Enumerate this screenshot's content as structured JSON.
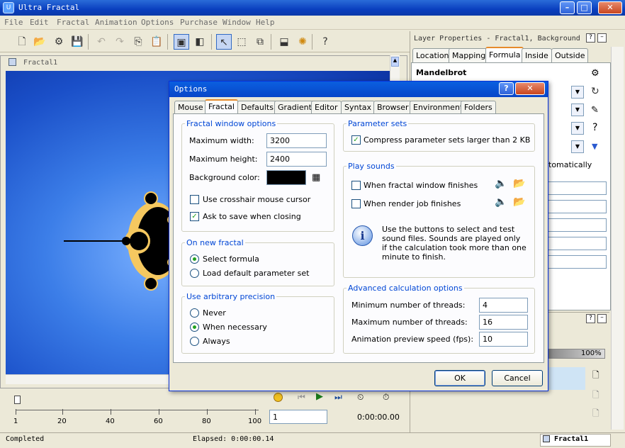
{
  "window": {
    "title": "Ultra Fractal",
    "icon_letter": "U"
  },
  "menu": [
    "File",
    "Edit",
    "Fractal",
    "Animation",
    "Options",
    "Purchase",
    "Window",
    "Help"
  ],
  "document": {
    "title": "Fractal1"
  },
  "timeline": {
    "ticks": [
      "1",
      "20",
      "40",
      "60",
      "80",
      "100"
    ],
    "frame": "1",
    "time": "0:00:00.00"
  },
  "status": {
    "left": "Completed",
    "elapsed": "Elapsed: 0:00:00.14",
    "tab": "Fractal1"
  },
  "layer_panel": {
    "title": "Layer Properties - Fractal1, Background",
    "tabs": [
      "Location",
      "Mapping",
      "Formula",
      "Inside",
      "Outside"
    ],
    "active_tab": "Formula",
    "formula_name": "Mandelbrot",
    "auto_text": "tomatically",
    "progress": "100%"
  },
  "dialog": {
    "title": "Options",
    "tabs": [
      "Mouse",
      "Fractal",
      "Defaults",
      "Gradient",
      "Editor",
      "Syntax",
      "Browser",
      "Environment",
      "Folders"
    ],
    "active_tab": "Fractal",
    "fractal_window": {
      "group_label": "Fractal window options",
      "max_width_label": "Maximum width:",
      "max_width": "3200",
      "max_height_label": "Maximum height:",
      "max_height": "2400",
      "bg_color_label": "Background color:",
      "bg_color": "#000000",
      "crosshair_label": "Use crosshair mouse cursor",
      "crosshair_checked": false,
      "ask_save_label": "Ask to save when closing",
      "ask_save_checked": true
    },
    "new_fractal": {
      "group_label": "On new fractal",
      "options": [
        "Select formula",
        "Load default parameter set"
      ],
      "selected": 0
    },
    "precision": {
      "group_label": "Use arbitrary precision",
      "options": [
        "Never",
        "When necessary",
        "Always"
      ],
      "selected": 1
    },
    "param_sets": {
      "group_label": "Parameter sets",
      "compress_label": "Compress parameter sets larger than 2 KB",
      "compress_checked": true
    },
    "sounds": {
      "group_label": "Play sounds",
      "window_finish_label": "When fractal window finishes",
      "render_finish_label": "When render job finishes",
      "info": "Use the buttons to select and test sound files. Sounds are played only if the calculation took more than one minute to finish."
    },
    "advanced": {
      "group_label": "Advanced calculation options",
      "min_threads_label": "Minimum number of threads:",
      "min_threads": "4",
      "max_threads_label": "Maximum number of threads:",
      "max_threads": "16",
      "anim_speed_label": "Animation preview speed (fps):",
      "anim_speed": "10"
    },
    "ok_label": "OK",
    "cancel_label": "Cancel"
  }
}
